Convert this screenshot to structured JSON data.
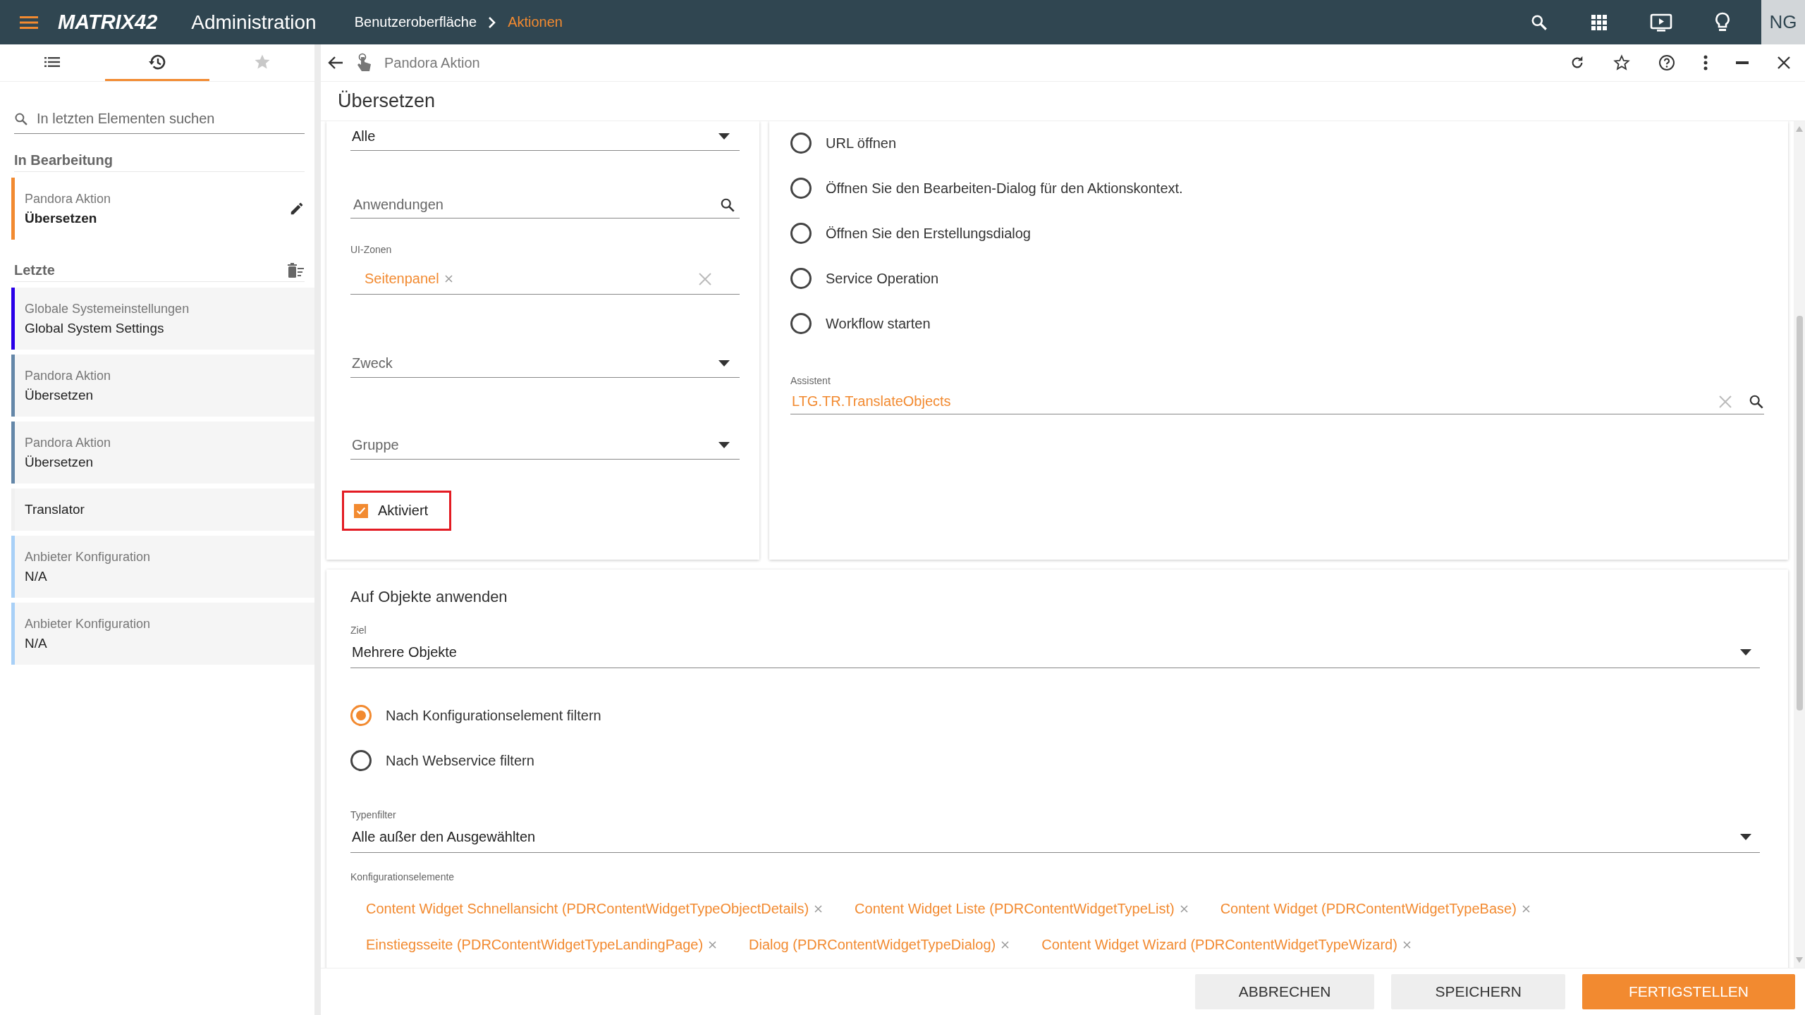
{
  "topbar": {
    "logo": "MATRIX42",
    "app_title": "Administration",
    "breadcrumb": [
      {
        "label": "Benutzeroberfläche",
        "current": false
      },
      {
        "label": "Aktionen",
        "current": true
      }
    ],
    "user_initials": "NG"
  },
  "sidebar": {
    "tabs": [
      {
        "kind": "list",
        "selected": false
      },
      {
        "kind": "history",
        "selected": true
      },
      {
        "kind": "star",
        "selected": false
      }
    ],
    "search": {
      "placeholder": "In letzten Elementen suchen"
    },
    "editing": {
      "heading": "In Bearbeitung",
      "items": [
        {
          "type": "Pandora Aktion",
          "name": "Übersetzen",
          "color": "#f28a30"
        }
      ]
    },
    "recent": {
      "heading": "Letzte",
      "items": [
        {
          "type": "Globale Systemeinstellungen",
          "name": "Global System Settings",
          "color": "#2a00e8"
        },
        {
          "type": "Pandora Aktion",
          "name": "Übersetzen",
          "color": "#6487a8"
        },
        {
          "type": "Pandora Aktion",
          "name": "Übersetzen",
          "color": "#6487a8"
        },
        {
          "name": "Translator"
        },
        {
          "type": "Anbieter Konfiguration",
          "name": "N/A",
          "color": "#a8d0f7"
        },
        {
          "type": "Anbieter Konfiguration",
          "name": "N/A",
          "color": "#a8d0f7"
        }
      ]
    }
  },
  "main": {
    "header": {
      "type": "Pandora Aktion"
    },
    "title": "Übersetzen",
    "left_fields": [
      {
        "kind": "select",
        "value": "Alle"
      },
      {
        "kind": "search",
        "placeholder": "Anwendungen"
      },
      {
        "kind": "tags",
        "label": "UI-Zonen",
        "tags": [
          "Seitenpanel"
        ]
      },
      {
        "kind": "select",
        "placeholder": "Zweck"
      },
      {
        "kind": "select",
        "placeholder": "Gruppe"
      },
      {
        "kind": "checkbox",
        "label": "Aktiviert",
        "checked": true,
        "highlighted": true
      }
    ],
    "action_options": [
      {
        "label": "URL öffnen",
        "selected": false
      },
      {
        "label": "Öffnen Sie den Bearbeiten-Dialog für den Aktionskontext.",
        "selected": false
      },
      {
        "label": "Öffnen Sie den Erstellungsdialog",
        "selected": false
      },
      {
        "label": "Service Operation",
        "selected": false
      },
      {
        "label": "Workflow starten",
        "selected": false
      }
    ],
    "assistant": {
      "label": "Assistent",
      "value": "LTG.TR.TranslateObjects"
    },
    "apply": {
      "heading": "Auf Objekte anwenden",
      "target": {
        "label": "Ziel",
        "value": "Mehrere Objekte"
      },
      "filters": [
        {
          "label": "Nach Konfigurationselement filtern",
          "selected": true
        },
        {
          "label": "Nach Webservice filtern",
          "selected": false
        }
      ],
      "type_filter": {
        "label": "Typenfilter",
        "value": "Alle außer den Ausgewählten"
      },
      "config_elements": {
        "label": "Konfigurationselemente",
        "tags": [
          "Content Widget Schnellansicht (PDRContentWidgetTypeObjectDetails)",
          "Content Widget Liste (PDRContentWidgetTypeList)",
          "Content Widget (PDRContentWidgetTypeBase)",
          "Einstiegsseite (PDRContentWidgetTypeLandingPage)",
          "Dialog (PDRContentWidgetTypeDialog)",
          "Content Widget Wizard (PDRContentWidgetTypeWizard)"
        ]
      }
    },
    "buttons": [
      {
        "label": "ABBRECHEN",
        "kind": "secondary"
      },
      {
        "label": "SPEICHERN",
        "kind": "secondary"
      },
      {
        "label": "FERTIGSTELLEN",
        "kind": "primary"
      }
    ]
  }
}
